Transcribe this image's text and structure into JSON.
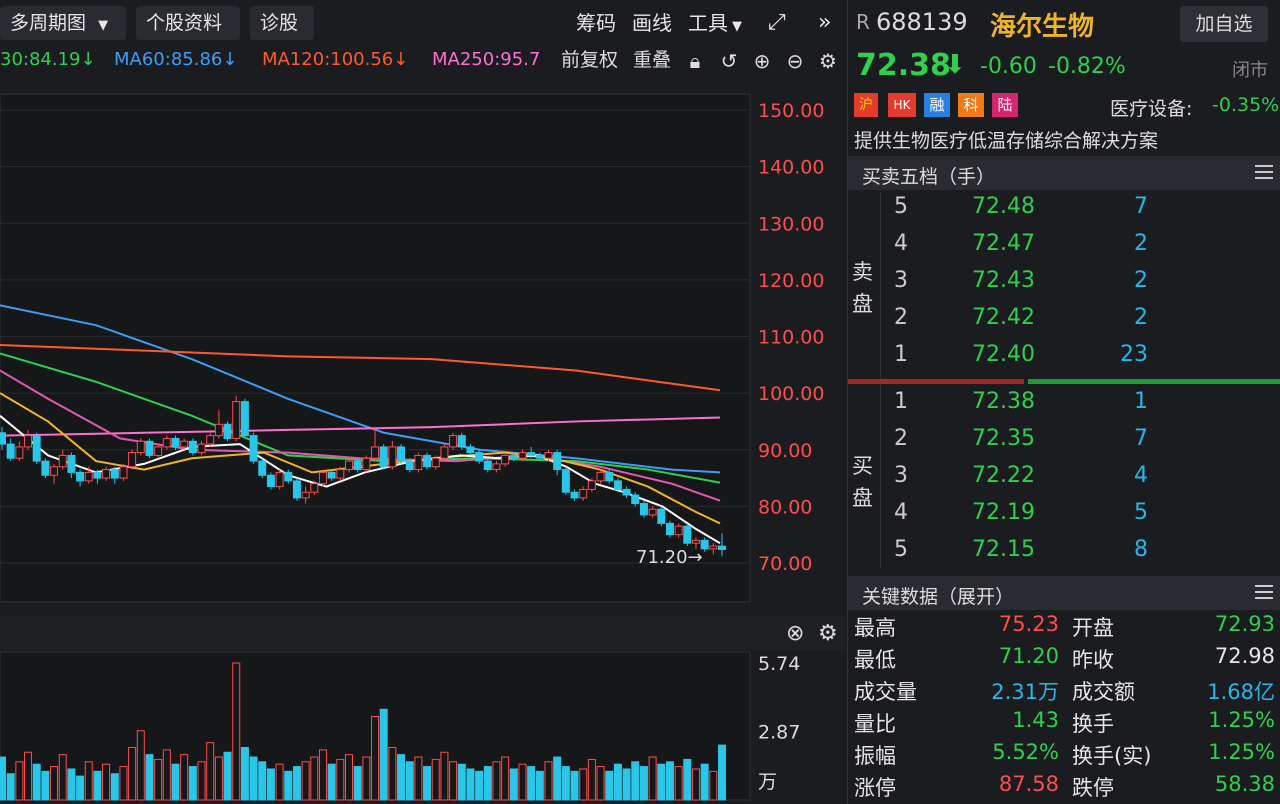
{
  "toolbar": {
    "period_label": "多周期图",
    "stock_info_label": "个股资料",
    "diagnose_label": "诊股",
    "chips_label": "筹码",
    "draw_label": "画线",
    "tools_label": "工具",
    "expand_icon": "fullscreen-icon",
    "more_icon": "double-chevron-right-icon"
  },
  "ma_row": {
    "ma30": "30:84.19",
    "ma60": "MA60:85.86",
    "ma120": "MA120:100.56",
    "ma250": "MA250:95.7",
    "adjust_label": "前复权",
    "overlay_label": "重叠",
    "colors": {
      "ma30": "#2fd04d",
      "ma60": "#3d9df5",
      "ma120": "#ff5a2a",
      "ma250": "#ff6fd1"
    }
  },
  "stock": {
    "market_tag": "R",
    "code": "688139",
    "name": "海尔生物",
    "add_button": "加自选",
    "price": "72.38",
    "change": "-0.60",
    "change_pct": "-0.82%",
    "status": "闭市",
    "badges": [
      "沪",
      "HK",
      "融",
      "科",
      "陆"
    ],
    "sector": "医疗设备:",
    "sector_change": "-0.35%",
    "description": "提供生物医疗低温存储综合解决方案"
  },
  "order_book": {
    "title": "买卖五档（手）",
    "sell_label": "卖盘",
    "buy_label": "买盘",
    "sell": [
      {
        "level": "5",
        "price": "72.48",
        "vol": "7"
      },
      {
        "level": "4",
        "price": "72.47",
        "vol": "2"
      },
      {
        "level": "3",
        "price": "72.43",
        "vol": "2"
      },
      {
        "level": "2",
        "price": "72.42",
        "vol": "2"
      },
      {
        "level": "1",
        "price": "72.40",
        "vol": "23"
      }
    ],
    "buy": [
      {
        "level": "1",
        "price": "72.38",
        "vol": "1"
      },
      {
        "level": "2",
        "price": "72.35",
        "vol": "7"
      },
      {
        "level": "3",
        "price": "72.22",
        "vol": "4"
      },
      {
        "level": "4",
        "price": "72.19",
        "vol": "5"
      },
      {
        "level": "5",
        "price": "72.15",
        "vol": "8"
      }
    ]
  },
  "key_data": {
    "title": "关键数据（展开）",
    "rows": [
      {
        "l1": "最高",
        "v1": "75.23",
        "l2": "开盘",
        "v2": "72.93"
      },
      {
        "l1": "最低",
        "v1": "71.20",
        "l2": "昨收",
        "v2": "72.98"
      },
      {
        "l1": "成交量",
        "v1": "2.31万",
        "l2": "成交额",
        "v2": "1.68亿"
      },
      {
        "l1": "量比",
        "v1": "1.43",
        "l2": "换手",
        "v2": "1.25%"
      },
      {
        "l1": "振幅",
        "v1": "5.52%",
        "l2": "换手(实)",
        "v2": "1.25%"
      },
      {
        "l1": "涨停",
        "v1": "87.58",
        "l2": "跌停",
        "v2": "58.38"
      }
    ]
  },
  "chart_data": {
    "type": "candlestick",
    "price_axis": {
      "ticks": [
        "150.00",
        "140.00",
        "130.00",
        "120.00",
        "110.00",
        "100.00",
        "90.00",
        "80.00",
        "70.00"
      ],
      "ylim": [
        66.8,
        153
      ]
    },
    "low_marker": "71.20→",
    "candles": [
      [
        93.0,
        91.0,
        94.0,
        90.0
      ],
      [
        91.0,
        88.5,
        92.0,
        88.0
      ],
      [
        88.5,
        90.5,
        91.5,
        88.0
      ],
      [
        90.5,
        92.5,
        93.5,
        90.0
      ],
      [
        92.5,
        88.0,
        93.0,
        87.5
      ],
      [
        88.0,
        85.5,
        88.5,
        85.0
      ],
      [
        85.5,
        87.0,
        87.5,
        84.0
      ],
      [
        87.0,
        89.0,
        90.0,
        86.5
      ],
      [
        89.0,
        86.0,
        89.5,
        85.0
      ],
      [
        86.0,
        84.5,
        86.5,
        83.5
      ],
      [
        84.5,
        86.0,
        87.0,
        84.0
      ],
      [
        86.0,
        85.0,
        86.5,
        84.0
      ],
      [
        85.0,
        86.5,
        87.0,
        84.5
      ],
      [
        86.5,
        85.0,
        87.0,
        84.0
      ],
      [
        85.0,
        87.0,
        87.5,
        84.5
      ],
      [
        87.0,
        89.5,
        90.0,
        86.5
      ],
      [
        89.5,
        91.5,
        92.0,
        89.0
      ],
      [
        91.5,
        89.0,
        92.0,
        88.5
      ],
      [
        89.0,
        90.5,
        91.0,
        88.5
      ],
      [
        90.5,
        92.0,
        92.5,
        90.0
      ],
      [
        92.0,
        90.5,
        92.5,
        90.0
      ],
      [
        90.5,
        91.5,
        92.0,
        90.0
      ],
      [
        91.5,
        89.5,
        92.0,
        89.0
      ],
      [
        89.5,
        91.0,
        91.5,
        89.0
      ],
      [
        91.0,
        92.5,
        93.0,
        90.5
      ],
      [
        92.5,
        94.5,
        97.0,
        92.0
      ],
      [
        94.5,
        92.0,
        95.0,
        91.5
      ],
      [
        92.0,
        98.5,
        99.5,
        91.5
      ],
      [
        98.5,
        92.5,
        99.0,
        92.0
      ],
      [
        92.5,
        88.0,
        93.0,
        87.5
      ],
      [
        88.0,
        85.5,
        88.5,
        85.0
      ],
      [
        85.5,
        83.5,
        86.0,
        83.0
      ],
      [
        83.5,
        86.0,
        86.5,
        83.0
      ],
      [
        86.0,
        84.5,
        86.5,
        84.0
      ],
      [
        84.5,
        81.5,
        85.0,
        81.0
      ],
      [
        81.5,
        82.5,
        83.5,
        80.5
      ],
      [
        82.5,
        84.0,
        84.5,
        82.0
      ],
      [
        84.0,
        86.0,
        86.5,
        83.5
      ],
      [
        86.0,
        85.0,
        86.5,
        84.5
      ],
      [
        85.0,
        86.5,
        87.0,
        84.5
      ],
      [
        86.5,
        88.0,
        88.5,
        86.0
      ],
      [
        88.0,
        86.5,
        88.5,
        86.0
      ],
      [
        86.5,
        88.5,
        89.0,
        86.0
      ],
      [
        88.5,
        90.5,
        94.0,
        88.0
      ],
      [
        90.5,
        87.0,
        91.0,
        86.5
      ],
      [
        87.0,
        90.5,
        91.5,
        86.5
      ],
      [
        90.5,
        88.0,
        91.0,
        87.5
      ],
      [
        88.0,
        86.5,
        88.5,
        86.0
      ],
      [
        86.5,
        89.0,
        89.5,
        86.0
      ],
      [
        89.0,
        87.0,
        89.5,
        86.5
      ],
      [
        87.0,
        88.5,
        89.0,
        86.5
      ],
      [
        88.5,
        90.5,
        91.0,
        88.0
      ],
      [
        90.5,
        92.5,
        93.0,
        90.0
      ],
      [
        92.5,
        90.5,
        93.0,
        90.0
      ],
      [
        90.5,
        89.5,
        91.0,
        89.0
      ],
      [
        89.5,
        88.0,
        90.0,
        87.5
      ],
      [
        88.0,
        86.5,
        88.5,
        86.0
      ],
      [
        86.5,
        87.5,
        88.0,
        86.0
      ],
      [
        87.5,
        89.0,
        89.5,
        87.0
      ],
      [
        89.0,
        88.5,
        89.5,
        88.0
      ],
      [
        88.5,
        89.5,
        90.0,
        88.0
      ],
      [
        89.5,
        89.0,
        90.5,
        88.5
      ],
      [
        89.0,
        88.5,
        89.5,
        88.0
      ],
      [
        88.5,
        89.5,
        90.0,
        88.0
      ],
      [
        89.5,
        86.5,
        90.0,
        85.5
      ],
      [
        86.5,
        82.5,
        87.0,
        82.0
      ],
      [
        82.5,
        81.5,
        83.0,
        81.0
      ],
      [
        81.5,
        83.0,
        83.5,
        81.0
      ],
      [
        83.0,
        84.5,
        85.0,
        82.5
      ],
      [
        84.5,
        86.0,
        86.5,
        84.0
      ],
      [
        86.0,
        84.5,
        86.5,
        84.0
      ],
      [
        84.5,
        83.0,
        85.0,
        82.5
      ],
      [
        83.0,
        82.0,
        83.5,
        81.5
      ],
      [
        82.0,
        80.5,
        82.5,
        80.0
      ],
      [
        80.5,
        78.5,
        81.0,
        78.0
      ],
      [
        78.5,
        79.5,
        80.0,
        78.0
      ],
      [
        79.5,
        77.0,
        80.0,
        76.5
      ],
      [
        77.0,
        75.0,
        77.5,
        74.5
      ],
      [
        75.0,
        76.5,
        77.0,
        74.5
      ],
      [
        76.5,
        73.5,
        77.0,
        73.0
      ],
      [
        73.5,
        74.0,
        74.5,
        72.5
      ],
      [
        74.0,
        72.5,
        74.5,
        72.0
      ],
      [
        72.5,
        73.0,
        73.5,
        71.5
      ],
      [
        72.98,
        72.38,
        75.23,
        71.2
      ]
    ],
    "ma_series": [
      {
        "name": "MA60",
        "color": "#3d9df5",
        "points": [
          [
            0,
            115.5
          ],
          [
            20,
            112.0
          ],
          [
            40,
            106.0
          ],
          [
            60,
            99.0
          ],
          [
            80,
            93.0
          ],
          [
            100,
            90.0
          ],
          [
            120,
            88.5
          ],
          [
            140,
            86.5
          ],
          [
            150,
            86.0
          ]
        ]
      },
      {
        "name": "MA120",
        "color": "#ff5a2a",
        "points": [
          [
            0,
            108.5
          ],
          [
            30,
            107.5
          ],
          [
            60,
            106.5
          ],
          [
            90,
            106.0
          ],
          [
            120,
            104.0
          ],
          [
            150,
            100.5
          ]
        ]
      },
      {
        "name": "MA250",
        "color": "#ff6fd1",
        "points": [
          [
            0,
            92.5
          ],
          [
            30,
            93.0
          ],
          [
            60,
            93.5
          ],
          [
            90,
            94.0
          ],
          [
            120,
            95.0
          ],
          [
            150,
            95.7
          ]
        ]
      },
      {
        "name": "MA30",
        "color": "#2fd04d",
        "points": [
          [
            0,
            107.0
          ],
          [
            20,
            102.0
          ],
          [
            40,
            96.0
          ],
          [
            60,
            89.0
          ],
          [
            80,
            88.0
          ],
          [
            100,
            88.5
          ],
          [
            120,
            88.0
          ],
          [
            135,
            86.5
          ],
          [
            150,
            84.2
          ]
        ]
      },
      {
        "name": "MA10",
        "color": "#e05ab0",
        "points": [
          [
            0,
            104.0
          ],
          [
            10,
            99.0
          ],
          [
            25,
            92.0
          ],
          [
            40,
            90.0
          ],
          [
            60,
            89.5
          ],
          [
            75,
            88.5
          ],
          [
            95,
            88.0
          ],
          [
            110,
            89.0
          ],
          [
            125,
            87.0
          ],
          [
            140,
            84.0
          ],
          [
            150,
            81.0
          ]
        ]
      },
      {
        "name": "MA5",
        "color": "#f0b429",
        "points": [
          [
            0,
            100.0
          ],
          [
            10,
            95.0
          ],
          [
            20,
            88.0
          ],
          [
            30,
            86.5
          ],
          [
            40,
            88.5
          ],
          [
            55,
            89.5
          ],
          [
            65,
            86.0
          ],
          [
            75,
            87.0
          ],
          [
            90,
            88.5
          ],
          [
            105,
            89.5
          ],
          [
            115,
            88.5
          ],
          [
            125,
            86.5
          ],
          [
            135,
            83.5
          ],
          [
            145,
            79.0
          ],
          [
            150,
            77.0
          ]
        ]
      },
      {
        "name": "MA3",
        "color": "#ffffff",
        "points": [
          [
            0,
            96.0
          ],
          [
            10,
            89.0
          ],
          [
            20,
            86.0
          ],
          [
            30,
            87.5
          ],
          [
            40,
            90.5
          ],
          [
            50,
            91.0
          ],
          [
            60,
            85.5
          ],
          [
            68,
            83.5
          ],
          [
            76,
            86.0
          ],
          [
            86,
            88.0
          ],
          [
            96,
            89.0
          ],
          [
            104,
            88.5
          ],
          [
            112,
            89.0
          ],
          [
            118,
            87.0
          ],
          [
            124,
            84.0
          ],
          [
            130,
            82.5
          ],
          [
            138,
            80.0
          ],
          [
            145,
            76.0
          ],
          [
            150,
            73.5
          ]
        ]
      }
    ],
    "volume_axis": {
      "ticks": [
        "5.74",
        "2.87"
      ],
      "unit": "万",
      "ylim": [
        0,
        6.2
      ]
    },
    "volumes": [
      1.8,
      1.1,
      1.6,
      2.0,
      1.5,
      1.2,
      1.4,
      1.9,
      1.3,
      1.0,
      1.6,
      1.2,
      1.5,
      1.1,
      1.4,
      2.2,
      2.9,
      1.9,
      1.7,
      2.1,
      1.5,
      1.9,
      1.4,
      1.6,
      2.4,
      1.8,
      2.0,
      5.74,
      2.2,
      1.8,
      1.6,
      1.3,
      1.5,
      1.2,
      1.4,
      1.6,
      1.8,
      2.1,
      1.5,
      1.7,
      1.9,
      1.4,
      1.8,
      3.5,
      3.8,
      2.2,
      1.9,
      1.6,
      1.8,
      1.4,
      1.7,
      2.0,
      1.6,
      1.5,
      1.3,
      1.2,
      1.4,
      1.6,
      1.8,
      1.3,
      1.5,
      1.4,
      1.2,
      1.6,
      1.8,
      1.4,
      1.2,
      1.3,
      1.7,
      1.4,
      1.2,
      1.5,
      1.3,
      1.6,
      1.4,
      1.8,
      1.5,
      1.6,
      1.4,
      1.7,
      1.3,
      1.5,
      1.2,
      2.3
    ]
  }
}
